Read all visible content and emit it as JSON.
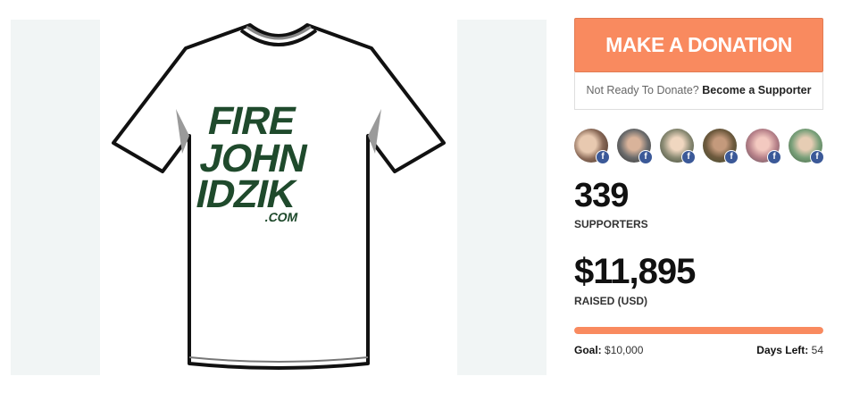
{
  "campaign": {
    "shirt_text": [
      "FIRE",
      "JOHN",
      "IDZIK",
      ".COM"
    ]
  },
  "donate": {
    "button_label": "MAKE A DONATION",
    "not_ready_text": "Not Ready To Donate?",
    "supporter_link": "Become a Supporter"
  },
  "supporters": {
    "avatars": [
      {
        "name": "supporter-1",
        "badge": "f"
      },
      {
        "name": "supporter-2",
        "badge": "f"
      },
      {
        "name": "supporter-3",
        "badge": "f"
      },
      {
        "name": "supporter-4",
        "badge": "f"
      },
      {
        "name": "supporter-5",
        "badge": "f"
      },
      {
        "name": "supporter-6",
        "badge": "f"
      }
    ],
    "count": "339",
    "label": "SUPPORTERS"
  },
  "raised": {
    "amount": "$11,895",
    "label": "RAISED (USD)",
    "progress_fraction": 1.0
  },
  "goal": {
    "label": "Goal:",
    "value": "$10,000"
  },
  "days_left": {
    "label": "Days Left:",
    "value": "54"
  },
  "colors": {
    "accent": "#f98a5f",
    "shirt_print": "#1f4a2c",
    "facebook": "#3b5998"
  }
}
